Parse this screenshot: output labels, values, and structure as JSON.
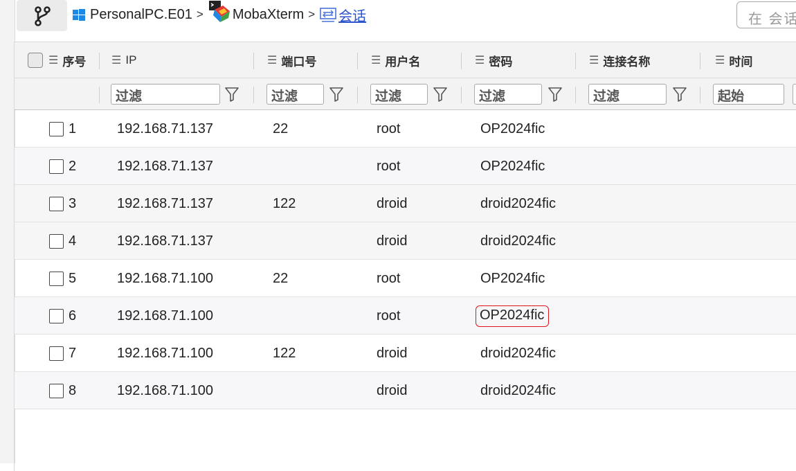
{
  "breadcrumb": {
    "items": [
      "PersonalPC.E01",
      "MobaXterm",
      "会话"
    ],
    "separator": ">"
  },
  "search": {
    "placeholder": "在 会话"
  },
  "columns": {
    "index": "序号",
    "ip": "IP",
    "port": "端口号",
    "user": "用户名",
    "password": "密码",
    "conn": "连接名称",
    "time": "时间"
  },
  "filters": {
    "ip": "过滤",
    "port": "过滤",
    "user": "过滤",
    "password": "过滤",
    "conn": "过滤",
    "time": "起始"
  },
  "rows": [
    {
      "index": "1",
      "ip": "192.168.71.137",
      "port": "22",
      "user": "root",
      "password": "OP2024fic"
    },
    {
      "index": "2",
      "ip": "192.168.71.137",
      "port": "",
      "user": "root",
      "password": "OP2024fic"
    },
    {
      "index": "3",
      "ip": "192.168.71.137",
      "port": "122",
      "user": "droid",
      "password": "droid2024fic"
    },
    {
      "index": "4",
      "ip": "192.168.71.137",
      "port": "",
      "user": "droid",
      "password": "droid2024fic"
    },
    {
      "index": "5",
      "ip": "192.168.71.100",
      "port": "22",
      "user": "root",
      "password": "OP2024fic"
    },
    {
      "index": "6",
      "ip": "192.168.71.100",
      "port": "",
      "user": "root",
      "password": "OP2024fic"
    },
    {
      "index": "7",
      "ip": "192.168.71.100",
      "port": "122",
      "user": "droid",
      "password": "droid2024fic"
    },
    {
      "index": "8",
      "ip": "192.168.71.100",
      "port": "",
      "user": "droid",
      "password": "droid2024fic"
    }
  ],
  "highlighted_cell": {
    "row": "6",
    "column": "password",
    "color": "#e0151c"
  },
  "icons": {
    "branch": "git-branch-icon",
    "windows": "windows-icon",
    "mobaxterm": "mobaxterm-icon",
    "session": "session-icon",
    "column_menu": "list-menu-icon",
    "filter": "filter-funnel-icon"
  }
}
